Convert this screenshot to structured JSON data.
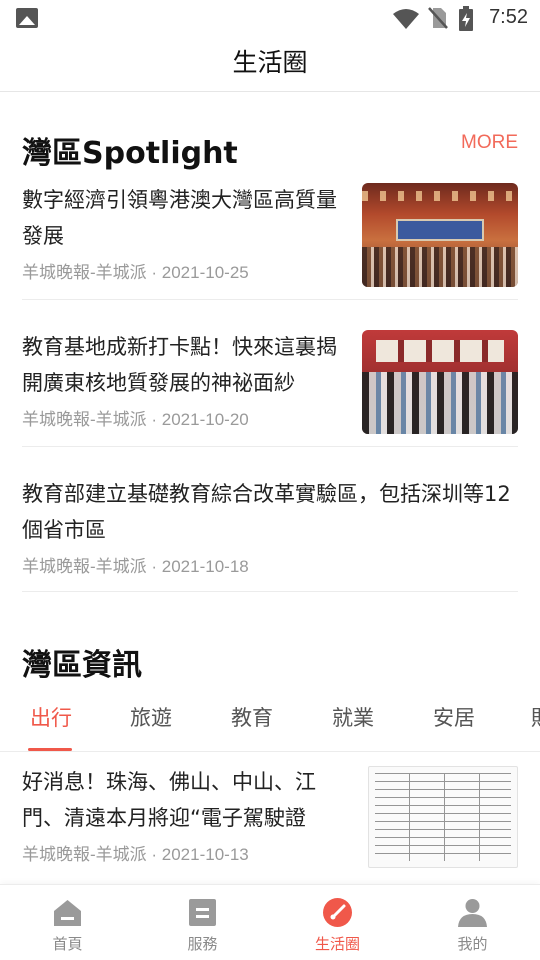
{
  "status_bar": {
    "time": "7:52"
  },
  "header": {
    "title": "生活圈"
  },
  "spotlight": {
    "heading": "灣區Spotlight",
    "more_label": "MORE",
    "items": [
      {
        "title": "數字經濟引領粵港澳大灣區高質量發展",
        "source": "羊城晚報-羊城派 · 2021-10-25",
        "thumbnail": "conference-hall-photo"
      },
      {
        "title": "教育基地成新打卡點！快來這裏揭開廣東核地質發展的神祕面紗",
        "source": "羊城晚報-羊城派 · 2021-10-20",
        "thumbnail": "exhibition-visitors-photo"
      },
      {
        "title": "教育部建立基礎教育綜合改革實驗區，包括深圳等12個省市區",
        "source": "羊城晚報-羊城派 · 2021-10-18"
      }
    ]
  },
  "news_info": {
    "heading": "灣區資訊",
    "tabs": [
      {
        "label": "出行",
        "active": true
      },
      {
        "label": "旅遊",
        "active": false
      },
      {
        "label": "教育",
        "active": false
      },
      {
        "label": "就業",
        "active": false
      },
      {
        "label": "安居",
        "active": false
      },
      {
        "label": "財",
        "active": false
      }
    ],
    "items": [
      {
        "title": "好消息！珠海、佛山、中山、江門、清遠本月將迎“電子駕駛證",
        "source": "羊城晚報-羊城派 · 2021-10-13",
        "thumbnail": "document-table-image"
      }
    ]
  },
  "bottom_nav": {
    "items": [
      {
        "label": "首頁",
        "icon": "home-icon",
        "active": false
      },
      {
        "label": "服務",
        "icon": "service-icon",
        "active": false
      },
      {
        "label": "生活圈",
        "icon": "life-circle-icon",
        "active": true
      },
      {
        "label": "我的",
        "icon": "profile-icon",
        "active": false
      }
    ]
  },
  "colors": {
    "accent": "#f0584a",
    "more": "#f26a5a",
    "meta_text": "#9a9a9a",
    "inactive_nav": "#8a8a8a"
  }
}
